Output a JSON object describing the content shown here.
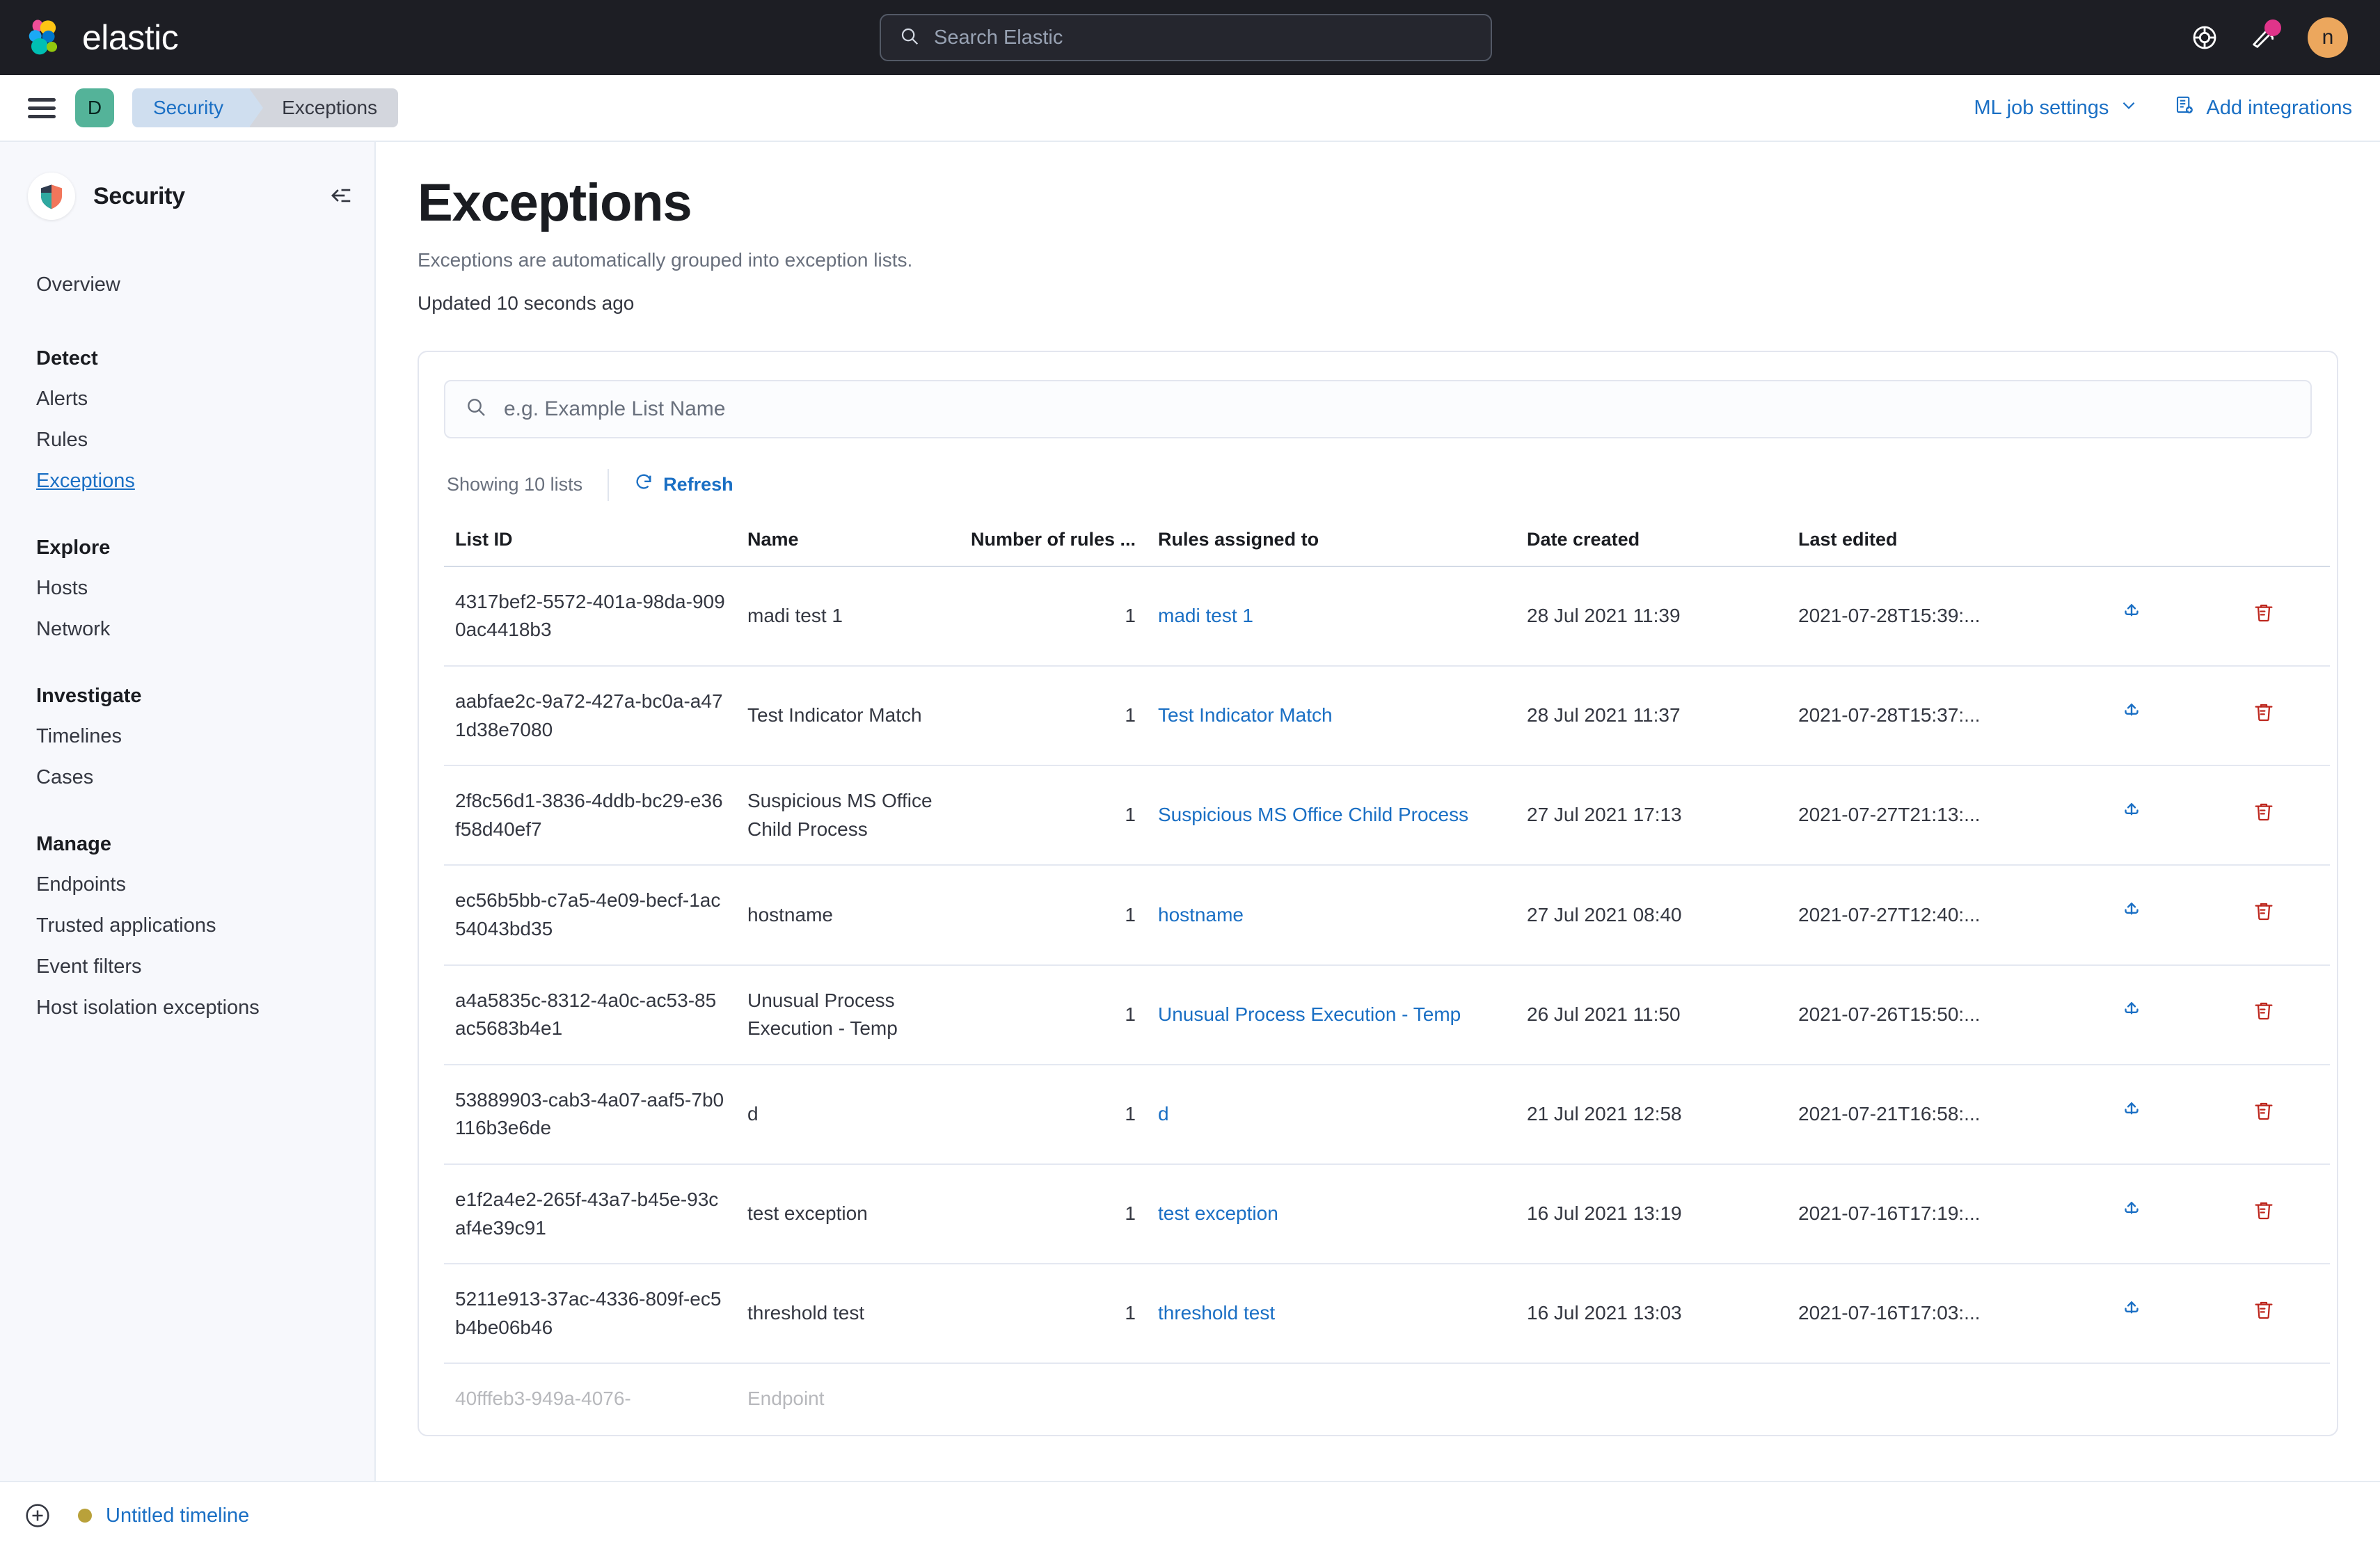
{
  "global_nav": {
    "brand": "elastic",
    "search_placeholder": "Search Elastic",
    "help_icon": "lifebuoy-icon",
    "news_icon": "megaphone-icon",
    "avatar_initial": "n"
  },
  "breadcrumb_bar": {
    "menu_icon": "hamburger-menu-icon",
    "space_initial": "D",
    "crumbs": [
      "Security",
      "Exceptions"
    ],
    "ml_job_settings": "ML job settings",
    "add_integrations": "Add integrations"
  },
  "sidebar": {
    "app_title": "Security",
    "collapse_icon": "collapse-panel-icon",
    "top_items": [
      {
        "label": "Overview",
        "active": false
      }
    ],
    "groups": [
      {
        "title": "Detect",
        "items": [
          {
            "label": "Alerts",
            "active": false
          },
          {
            "label": "Rules",
            "active": false
          },
          {
            "label": "Exceptions",
            "active": true
          }
        ]
      },
      {
        "title": "Explore",
        "items": [
          {
            "label": "Hosts",
            "active": false
          },
          {
            "label": "Network",
            "active": false
          }
        ]
      },
      {
        "title": "Investigate",
        "items": [
          {
            "label": "Timelines",
            "active": false
          },
          {
            "label": "Cases",
            "active": false
          }
        ]
      },
      {
        "title": "Manage",
        "items": [
          {
            "label": "Endpoints",
            "active": false
          },
          {
            "label": "Trusted applications",
            "active": false
          },
          {
            "label": "Event filters",
            "active": false
          },
          {
            "label": "Host isolation exceptions",
            "active": false
          }
        ]
      }
    ]
  },
  "main": {
    "title": "Exceptions",
    "subtitle": "Exceptions are automatically grouped into exception lists.",
    "updated": "Updated 10 seconds ago",
    "search_placeholder": "e.g. Example List Name",
    "showing": "Showing 10 lists",
    "refresh_label": "Refresh",
    "columns": [
      "List ID",
      "Name",
      "Number of rules ...",
      "Rules assigned to",
      "Date created",
      "Last edited"
    ],
    "rows": [
      {
        "list_id": "4317bef2-5572-401a-98da-9090ac4418b3",
        "name": "madi test 1",
        "rule_count": "1",
        "rules_assigned_to": "madi test 1",
        "date_created": "28 Jul 2021 11:39",
        "last_edited": "2021-07-28T15:39:..."
      },
      {
        "list_id": "aabfae2c-9a72-427a-bc0a-a471d38e7080",
        "name": "Test Indicator Match",
        "rule_count": "1",
        "rules_assigned_to": "Test Indicator Match",
        "date_created": "28 Jul 2021 11:37",
        "last_edited": "2021-07-28T15:37:..."
      },
      {
        "list_id": "2f8c56d1-3836-4ddb-bc29-e36f58d40ef7",
        "name": "Suspicious MS Office Child Process",
        "rule_count": "1",
        "rules_assigned_to": "Suspicious MS Office Child Process",
        "date_created": "27 Jul 2021 17:13",
        "last_edited": "2021-07-27T21:13:..."
      },
      {
        "list_id": "ec56b5bb-c7a5-4e09-becf-1ac54043bd35",
        "name": "hostname",
        "rule_count": "1",
        "rules_assigned_to": "hostname",
        "date_created": "27 Jul 2021 08:40",
        "last_edited": "2021-07-27T12:40:..."
      },
      {
        "list_id": "a4a5835c-8312-4a0c-ac53-85ac5683b4e1",
        "name": "Unusual Process Execution - Temp",
        "rule_count": "1",
        "rules_assigned_to": "Unusual Process Execution - Temp",
        "date_created": "26 Jul 2021 11:50",
        "last_edited": "2021-07-26T15:50:..."
      },
      {
        "list_id": "53889903-cab3-4a07-aaf5-7b0116b3e6de",
        "name": "d",
        "rule_count": "1",
        "rules_assigned_to": "d",
        "date_created": "21 Jul 2021 12:58",
        "last_edited": "2021-07-21T16:58:..."
      },
      {
        "list_id": "e1f2a4e2-265f-43a7-b45e-93caf4e39c91",
        "name": "test exception",
        "rule_count": "1",
        "rules_assigned_to": "test exception",
        "date_created": "16 Jul 2021 13:19",
        "last_edited": "2021-07-16T17:19:..."
      },
      {
        "list_id": "5211e913-37ac-4336-809f-ec5b4be06b46",
        "name": "threshold test",
        "rule_count": "1",
        "rules_assigned_to": "threshold test",
        "date_created": "16 Jul 2021 13:03",
        "last_edited": "2021-07-16T17:03:..."
      }
    ],
    "clipped_row": {
      "list_id": "40fffeb3-949a-4076-",
      "name": "Endpoint"
    },
    "export_icon": "export-icon",
    "delete_icon": "trash-icon"
  },
  "bottom_bar": {
    "add_icon": "plus-circle-icon",
    "timeline_label": "Untitled timeline"
  },
  "colors": {
    "nav_bg": "#1d1e24",
    "link": "#1a6fc4",
    "danger": "#bd271e",
    "space_badge": "#54b399",
    "avatar": "#eca75d",
    "notification": "#e0348a",
    "timeline_dot": "#b9a13a"
  }
}
